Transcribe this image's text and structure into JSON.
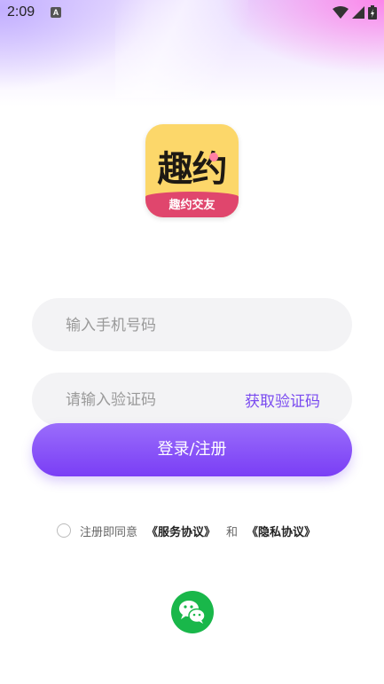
{
  "status_bar": {
    "time": "2:09",
    "a_badge": "A"
  },
  "logo": {
    "title": "趣约",
    "subtitle": "趣约交友"
  },
  "phone_input": {
    "placeholder": "输入手机号码",
    "value": ""
  },
  "code_input": {
    "placeholder": "请输入验证码",
    "value": ""
  },
  "get_code_label": "获取验证码",
  "login_button_label": "登录/注册",
  "agreement": {
    "prefix": "注册即同意",
    "service_link": "《服务协议》",
    "and": "和",
    "privacy_link": "《隐私协议》"
  },
  "colors": {
    "accent": "#7a3ef5",
    "logo_yellow": "#fcd76a",
    "logo_band": "#e0466d",
    "wechat_green": "#19b74a"
  },
  "icons": [
    "wifi-icon",
    "signal-icon",
    "battery-icon",
    "radio-icon",
    "wechat-icon"
  ]
}
